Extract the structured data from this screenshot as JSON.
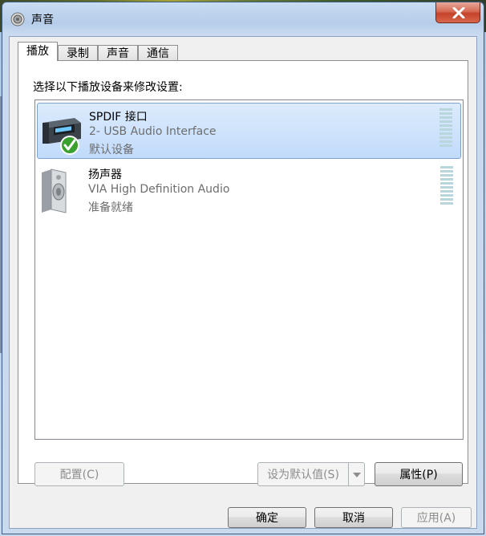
{
  "window": {
    "title": "声音",
    "title_icon": "speaker-icon",
    "close_icon": "close-icon"
  },
  "tabs": [
    {
      "label": "播放",
      "active": true
    },
    {
      "label": "录制",
      "active": false
    },
    {
      "label": "声音",
      "active": false
    },
    {
      "label": "通信",
      "active": false
    }
  ],
  "panel": {
    "instruction": "选择以下播放设备来修改设置:"
  },
  "devices": [
    {
      "name": "SPDIF 接口",
      "description": "2- USB Audio Interface",
      "status": "默认设备",
      "icon": "spdif-device-icon",
      "badge_icon": "default-check-icon",
      "selected": true
    },
    {
      "name": "扬声器",
      "description": "VIA High Definition Audio",
      "status": "准备就绪",
      "icon": "speaker-device-icon",
      "selected": false
    }
  ],
  "panel_buttons": {
    "configure": "配置(C)",
    "set_default": "设为默认值(S)",
    "properties": "属性(P)"
  },
  "dialog_buttons": {
    "ok": "确定",
    "cancel": "取消",
    "apply": "应用(A)"
  },
  "colors": {
    "selection_border": "#7da2ce",
    "selection_fill": "#c1dbfc",
    "level_meter": "#b8d6dc",
    "close_red": "#c4422a"
  }
}
